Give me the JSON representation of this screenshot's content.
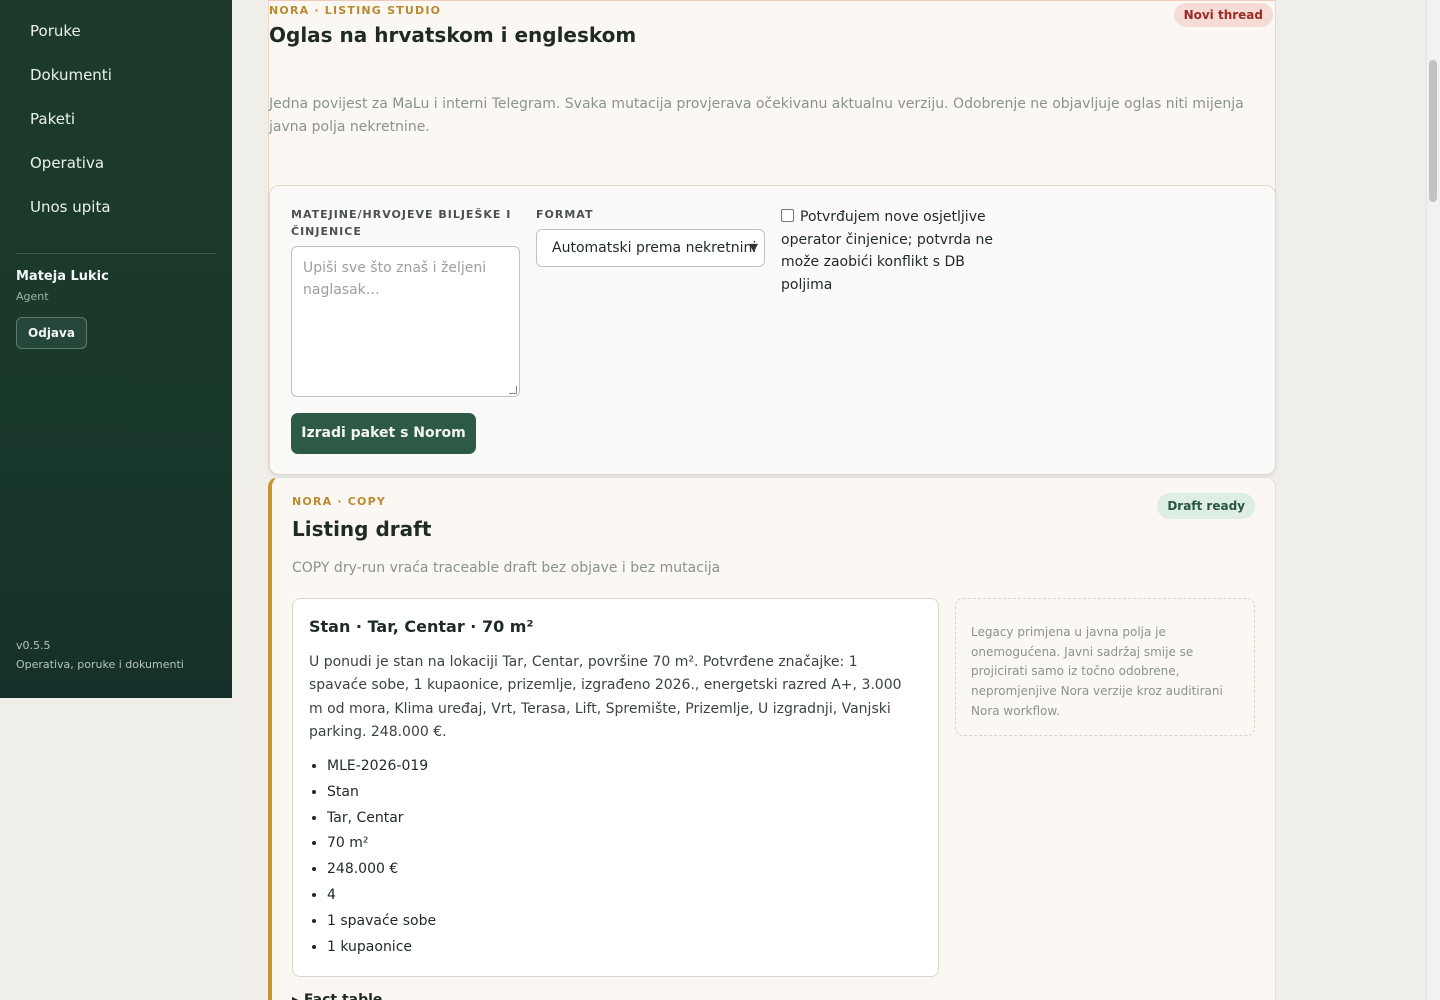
{
  "sidebar": {
    "nav": [
      "Poruke",
      "Dokumenti",
      "Paketi",
      "Operativa",
      "Unos upita"
    ],
    "user_name": "Mateja Lukic",
    "user_role": "Agent",
    "logout_label": "Odjava",
    "version": "v0.5.5",
    "tagline": "Operativa, poruke i dokumenti"
  },
  "studio": {
    "eyebrow": "NORA · LISTING STUDIO",
    "title": "Oglas na hrvatskom i engleskom",
    "badge": "Novi thread",
    "description": "Jedna povijest za MaLu i interni Telegram. Svaka mutacija provjerava očekivanu aktualnu verziju. Odobrenje ne objavljuje oglas niti mijenja javna polja nekretnine.",
    "form": {
      "notes_label": "MATEJINE/HRVOJEVE BILJEŠKE I ČINJENICE",
      "notes_placeholder": "Upiši sve što znaš i željeni naglasak…",
      "format_label": "FORMAT",
      "format_value": "Automatski prema nekretnini",
      "confirm_text": "Potvrđujem nove osjetljive operator činjenice; potvrda ne može zaobići konflikt s DB poljima",
      "submit_label": "Izradi paket s Norom"
    }
  },
  "copy": {
    "eyebrow": "NORA · COPY",
    "title": "Listing draft",
    "badge": "Draft ready",
    "description": "COPY dry-run vraća traceable draft bez objave i bez mutacija",
    "draft": {
      "heading": "Stan · Tar, Centar · 70 m²",
      "body": "U ponudi je stan na lokaciji Tar, Centar, površine 70 m². Potvrđene značajke: 1 spavaće sobe, 1 kupaonice, prizemlje, izgrađeno 2026., energetski razred A+, 3.000 m od mora, Klima uređaj, Vrt, Terasa, Lift, Spremište, Prizemlje, U izgradnji, Vanjski parking. 248.000 €.",
      "facts": [
        "MLE-2026-019",
        "Stan",
        "Tar, Centar",
        "70 m²",
        "248.000 €",
        "4",
        "1 spavaće sobe",
        "1 kupaonice"
      ]
    },
    "legacy_note": "Legacy primjena u javna polja je onemogućena. Javni sadržaj smije se projicirati samo iz točno odobrene, nepromjenjive Nora verzije kroz auditirani Nora workflow.",
    "fact_table_label": "Fact table"
  },
  "colors": {
    "sidebar_bg": "#1d3a2c",
    "accent_gold": "#c9962e",
    "primary_button": "#2c5a44",
    "badge_red": "#9a2b25",
    "badge_green": "#285540"
  }
}
